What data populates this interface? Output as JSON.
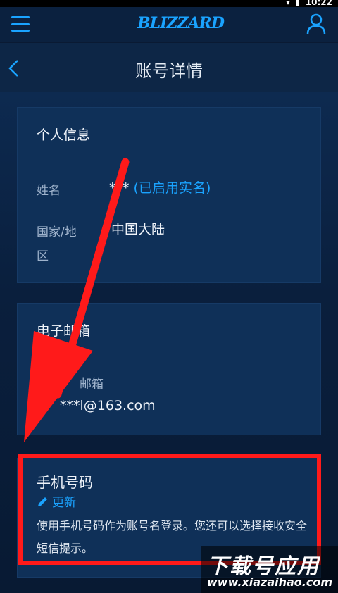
{
  "status": {
    "time": "10:22"
  },
  "app": {
    "logo": "BLIZZARD"
  },
  "header": {
    "title": "账号详情"
  },
  "personal_info": {
    "title": "个人信息",
    "name_label": "姓名",
    "name_value": "*** ",
    "name_status": "(已启用实名)",
    "country_label": "国家/地区",
    "country_value": "中国大陆"
  },
  "email": {
    "title": "电子邮箱",
    "label": "邮箱",
    "value": "***l@163.com"
  },
  "phone": {
    "title": "手机号码",
    "update_label": "更新",
    "description": "使用手机号码作为账号名登录。您还可以选择接收安全短信提示。"
  },
  "watermark": {
    "main": "下载号应用",
    "url": "www.xiazaihao.com"
  },
  "colors": {
    "accent": "#1aa3ff",
    "highlight": "#ff1a1a",
    "background": "#0a1a33",
    "card": "#0f3058"
  }
}
